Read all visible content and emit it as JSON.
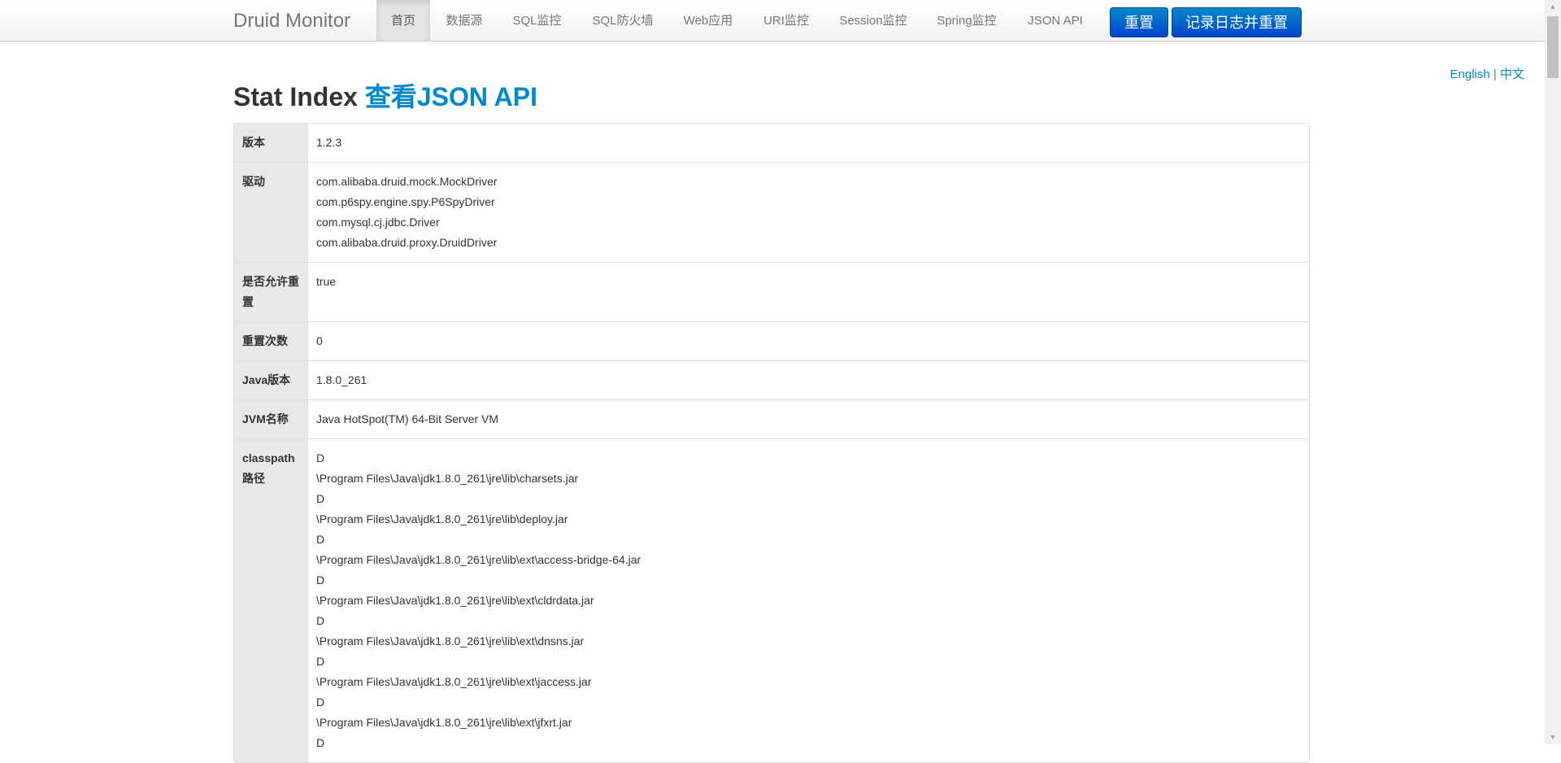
{
  "navbar": {
    "brand": "Druid Monitor",
    "items": [
      {
        "label": "首页",
        "active": true
      },
      {
        "label": "数据源"
      },
      {
        "label": "SQL监控"
      },
      {
        "label": "SQL防火墙"
      },
      {
        "label": "Web应用"
      },
      {
        "label": "URI监控"
      },
      {
        "label": "Session监控"
      },
      {
        "label": "Spring监控"
      },
      {
        "label": "JSON API"
      }
    ],
    "reset_button": "重置",
    "log_reset_button": "记录日志并重置"
  },
  "lang": {
    "english": "English",
    "separator": "|",
    "chinese": "中文"
  },
  "title": {
    "text": "Stat Index ",
    "link": "查看JSON API"
  },
  "table": {
    "rows": [
      {
        "label": "版本",
        "values": [
          "1.2.3"
        ]
      },
      {
        "label": "驱动",
        "values": [
          "com.alibaba.druid.mock.MockDriver",
          "com.p6spy.engine.spy.P6SpyDriver",
          "com.mysql.cj.jdbc.Driver",
          "com.alibaba.druid.proxy.DruidDriver"
        ]
      },
      {
        "label": "是否允许重置",
        "values": [
          "true"
        ]
      },
      {
        "label": "重置次数",
        "values": [
          "0"
        ]
      },
      {
        "label": "Java版本",
        "values": [
          "1.8.0_261"
        ]
      },
      {
        "label": "JVM名称",
        "values": [
          "Java HotSpot(TM) 64-Bit Server VM"
        ]
      },
      {
        "label": "classpath路径",
        "values": [
          "D",
          "\\Program Files\\Java\\jdk1.8.0_261\\jre\\lib\\charsets.jar",
          "D",
          "\\Program Files\\Java\\jdk1.8.0_261\\jre\\lib\\deploy.jar",
          "D",
          "\\Program Files\\Java\\jdk1.8.0_261\\jre\\lib\\ext\\access-bridge-64.jar",
          "D",
          "\\Program Files\\Java\\jdk1.8.0_261\\jre\\lib\\ext\\cldrdata.jar",
          "D",
          "\\Program Files\\Java\\jdk1.8.0_261\\jre\\lib\\ext\\dnsns.jar",
          "D",
          "\\Program Files\\Java\\jdk1.8.0_261\\jre\\lib\\ext\\jaccess.jar",
          "D",
          "\\Program Files\\Java\\jdk1.8.0_261\\jre\\lib\\ext\\jfxrt.jar",
          "D"
        ]
      }
    ]
  },
  "colors": {
    "accent": "#0088cc",
    "button_primary": "#0044cc",
    "label_bg": "#e8e8e8"
  }
}
